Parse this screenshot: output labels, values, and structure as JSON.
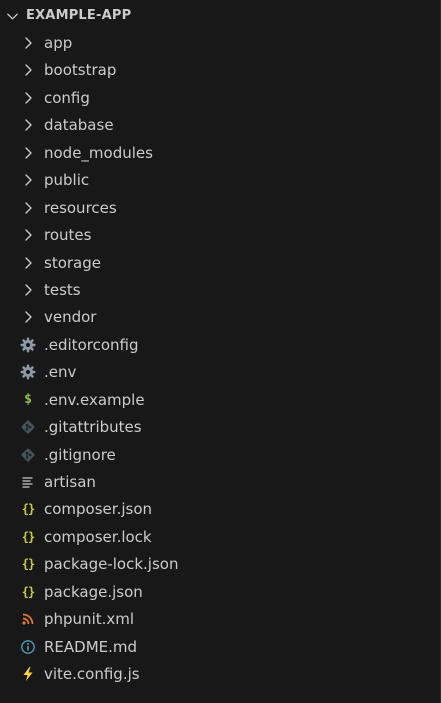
{
  "explorer": {
    "root_label": "EXAMPLE-APP",
    "root_icon": "chevron-down-icon",
    "items": [
      {
        "label": "app",
        "icon": "chevron-right-icon",
        "kind": "folder"
      },
      {
        "label": "bootstrap",
        "icon": "chevron-right-icon",
        "kind": "folder"
      },
      {
        "label": "config",
        "icon": "chevron-right-icon",
        "kind": "folder"
      },
      {
        "label": "database",
        "icon": "chevron-right-icon",
        "kind": "folder"
      },
      {
        "label": "node_modules",
        "icon": "chevron-right-icon",
        "kind": "folder"
      },
      {
        "label": "public",
        "icon": "chevron-right-icon",
        "kind": "folder"
      },
      {
        "label": "resources",
        "icon": "chevron-right-icon",
        "kind": "folder"
      },
      {
        "label": "routes",
        "icon": "chevron-right-icon",
        "kind": "folder"
      },
      {
        "label": "storage",
        "icon": "chevron-right-icon",
        "kind": "folder"
      },
      {
        "label": "tests",
        "icon": "chevron-right-icon",
        "kind": "folder"
      },
      {
        "label": "vendor",
        "icon": "chevron-right-icon",
        "kind": "folder"
      },
      {
        "label": ".editorconfig",
        "icon": "gear-icon",
        "kind": "file"
      },
      {
        "label": ".env",
        "icon": "gear-icon",
        "kind": "file"
      },
      {
        "label": ".env.example",
        "icon": "dollar-icon",
        "kind": "file"
      },
      {
        "label": ".gitattributes",
        "icon": "git-icon",
        "kind": "file"
      },
      {
        "label": ".gitignore",
        "icon": "git-icon",
        "kind": "file"
      },
      {
        "label": "artisan",
        "icon": "text-lines-icon",
        "kind": "file"
      },
      {
        "label": "composer.json",
        "icon": "braces-icon",
        "kind": "file"
      },
      {
        "label": "composer.lock",
        "icon": "braces-icon",
        "kind": "file"
      },
      {
        "label": "package-lock.json",
        "icon": "braces-icon",
        "kind": "file"
      },
      {
        "label": "package.json",
        "icon": "braces-icon",
        "kind": "file"
      },
      {
        "label": "phpunit.xml",
        "icon": "rss-icon",
        "kind": "file"
      },
      {
        "label": "README.md",
        "icon": "info-icon",
        "kind": "file"
      },
      {
        "label": "vite.config.js",
        "icon": "lightning-icon",
        "kind": "file"
      }
    ]
  },
  "colors": {
    "background": "#181818",
    "text": "#cccccc",
    "gear": "#8f9aa8",
    "dollar": "#8dc149",
    "git": "#41535b",
    "braces": "#cbcb41",
    "rss": "#e37933",
    "info": "#519aba",
    "lightning": "#ffd43b"
  }
}
